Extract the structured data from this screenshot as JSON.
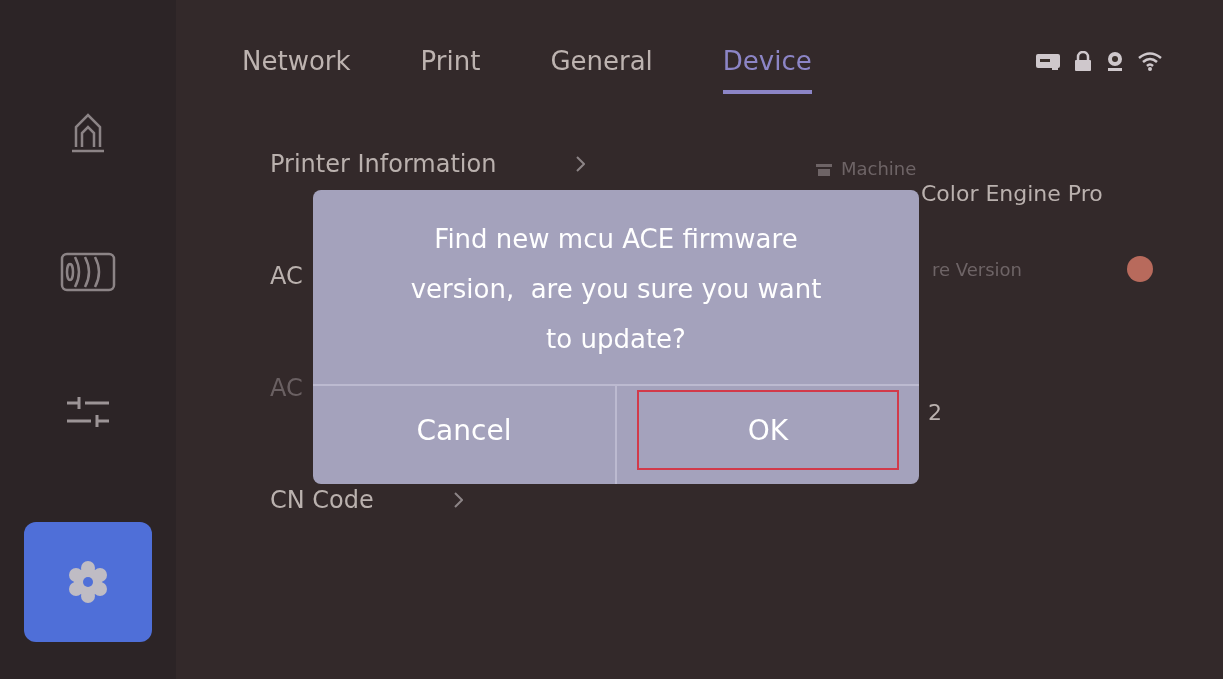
{
  "sidebar": {
    "items": [
      {
        "kind": "home",
        "selected": false
      },
      {
        "kind": "filament",
        "selected": false
      },
      {
        "kind": "tune",
        "selected": false
      },
      {
        "kind": "settings",
        "selected": true
      }
    ]
  },
  "tabs": [
    {
      "label": "Network",
      "selected": false
    },
    {
      "label": "Print",
      "selected": false
    },
    {
      "label": "General",
      "selected": false
    },
    {
      "label": "Device",
      "selected": true
    }
  ],
  "settings_list": [
    {
      "label": "Printer Information",
      "chevron": true,
      "disabled": false
    },
    {
      "label": "AC",
      "chevron": false,
      "disabled": false
    },
    {
      "label": "AC",
      "chevron": false,
      "disabled": true
    },
    {
      "label": "CN Code",
      "chevron": true,
      "disabled": false
    }
  ],
  "details": [
    {
      "kind": "label",
      "text": "Machine",
      "badge": false
    },
    {
      "kind": "value",
      "text": "Color Engine Pro",
      "badge": false
    },
    {
      "kind": "label",
      "text": "re Version",
      "badge": true
    },
    {
      "kind": "value",
      "text": "2",
      "badge": false
    }
  ],
  "dialog": {
    "message": "Find new mcu ACE firmware\nversion,  are you sure you want\nto update?",
    "buttons": [
      {
        "label": "Cancel",
        "selected": false
      },
      {
        "label": "OK",
        "selected": true
      }
    ]
  }
}
